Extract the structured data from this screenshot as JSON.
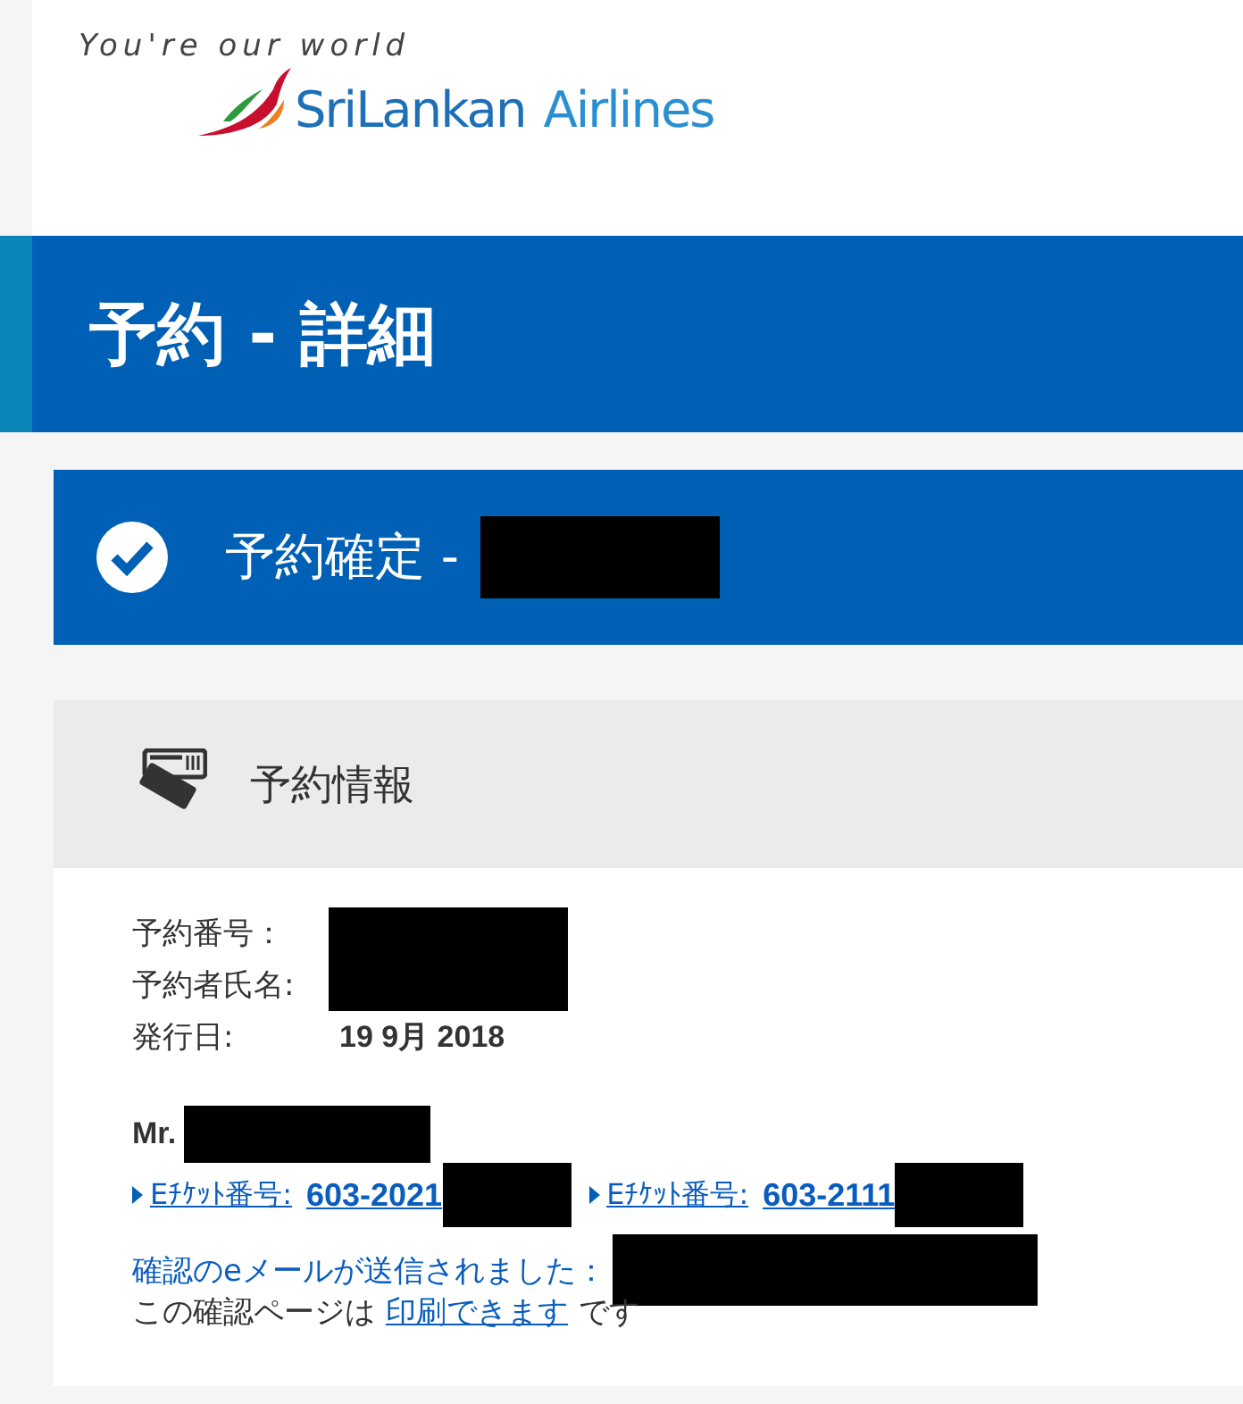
{
  "brand": {
    "tagline": "You're our world",
    "name_first": "SriLankan",
    "name_second": "Airlines"
  },
  "page_title": "予約 - 詳細",
  "confirmation": {
    "title": "予約確定 -",
    "redacted": true
  },
  "section": {
    "title": "予約情報",
    "fields": [
      {
        "label": "予約番号：",
        "redacted": true
      },
      {
        "label": "予約者氏名:",
        "redacted": true
      },
      {
        "label": "発行日:",
        "value": "19 9月 2018",
        "redacted": false
      }
    ]
  },
  "passenger": {
    "title": "Mr.",
    "redacted": true
  },
  "tickets": [
    {
      "label": "Eﾁｹｯﾄ番号:",
      "number": "603-2021",
      "redacted": true
    },
    {
      "label": "Eﾁｹｯﾄ番号:",
      "number": "603-2111",
      "redacted": true
    }
  ],
  "email": {
    "text": "確認のeメールが送信されました：",
    "redacted": true
  },
  "print": {
    "before": "この確認ページは",
    "link": "印刷できます",
    "after": "です"
  }
}
